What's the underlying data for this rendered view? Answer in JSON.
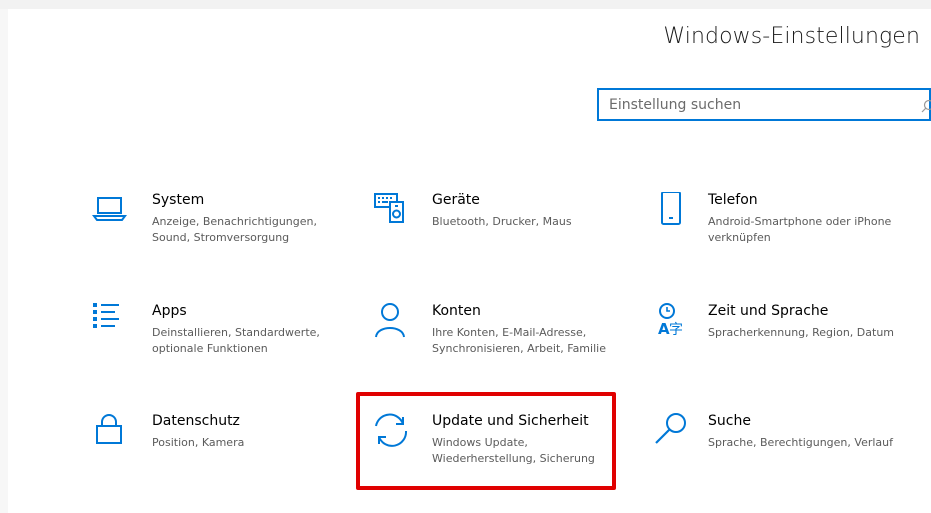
{
  "header": {
    "title": "Windows-Einstellungen"
  },
  "search": {
    "placeholder": "Einstellung suchen",
    "value": ""
  },
  "accent_color": "#0078d7",
  "highlight_color": "#e00000",
  "tiles": [
    {
      "id": "system",
      "icon": "laptop-icon",
      "name": "System",
      "desc": "Anzeige, Benachrichtigungen, Sound, Stromversorgung"
    },
    {
      "id": "geraete",
      "icon": "devices-icon",
      "name": "Geräte",
      "desc": "Bluetooth, Drucker, Maus"
    },
    {
      "id": "telefon",
      "icon": "phone-icon",
      "name": "Telefon",
      "desc": "Android-Smartphone oder iPhone verknüpfen"
    },
    {
      "id": "apps",
      "icon": "apps-list-icon",
      "name": "Apps",
      "desc": "Deinstallieren, Standardwerte, optionale Funktionen"
    },
    {
      "id": "konten",
      "icon": "person-icon",
      "name": "Konten",
      "desc": "Ihre Konten, E-Mail-Adresse, Synchronisieren, Arbeit, Familie"
    },
    {
      "id": "zeit",
      "icon": "time-language-icon",
      "name": "Zeit und Sprache",
      "desc": "Spracherkennung, Region, Datum"
    },
    {
      "id": "datenschutz",
      "icon": "lock-icon",
      "name": "Datenschutz",
      "desc": "Position, Kamera"
    },
    {
      "id": "update",
      "icon": "sync-icon",
      "name": "Update und Sicherheit",
      "desc": "Windows Update, Wiederherstellung, Sicherung"
    },
    {
      "id": "suche",
      "icon": "search-icon",
      "name": "Suche",
      "desc": "Sprache, Berechtigungen, Verlauf"
    }
  ]
}
